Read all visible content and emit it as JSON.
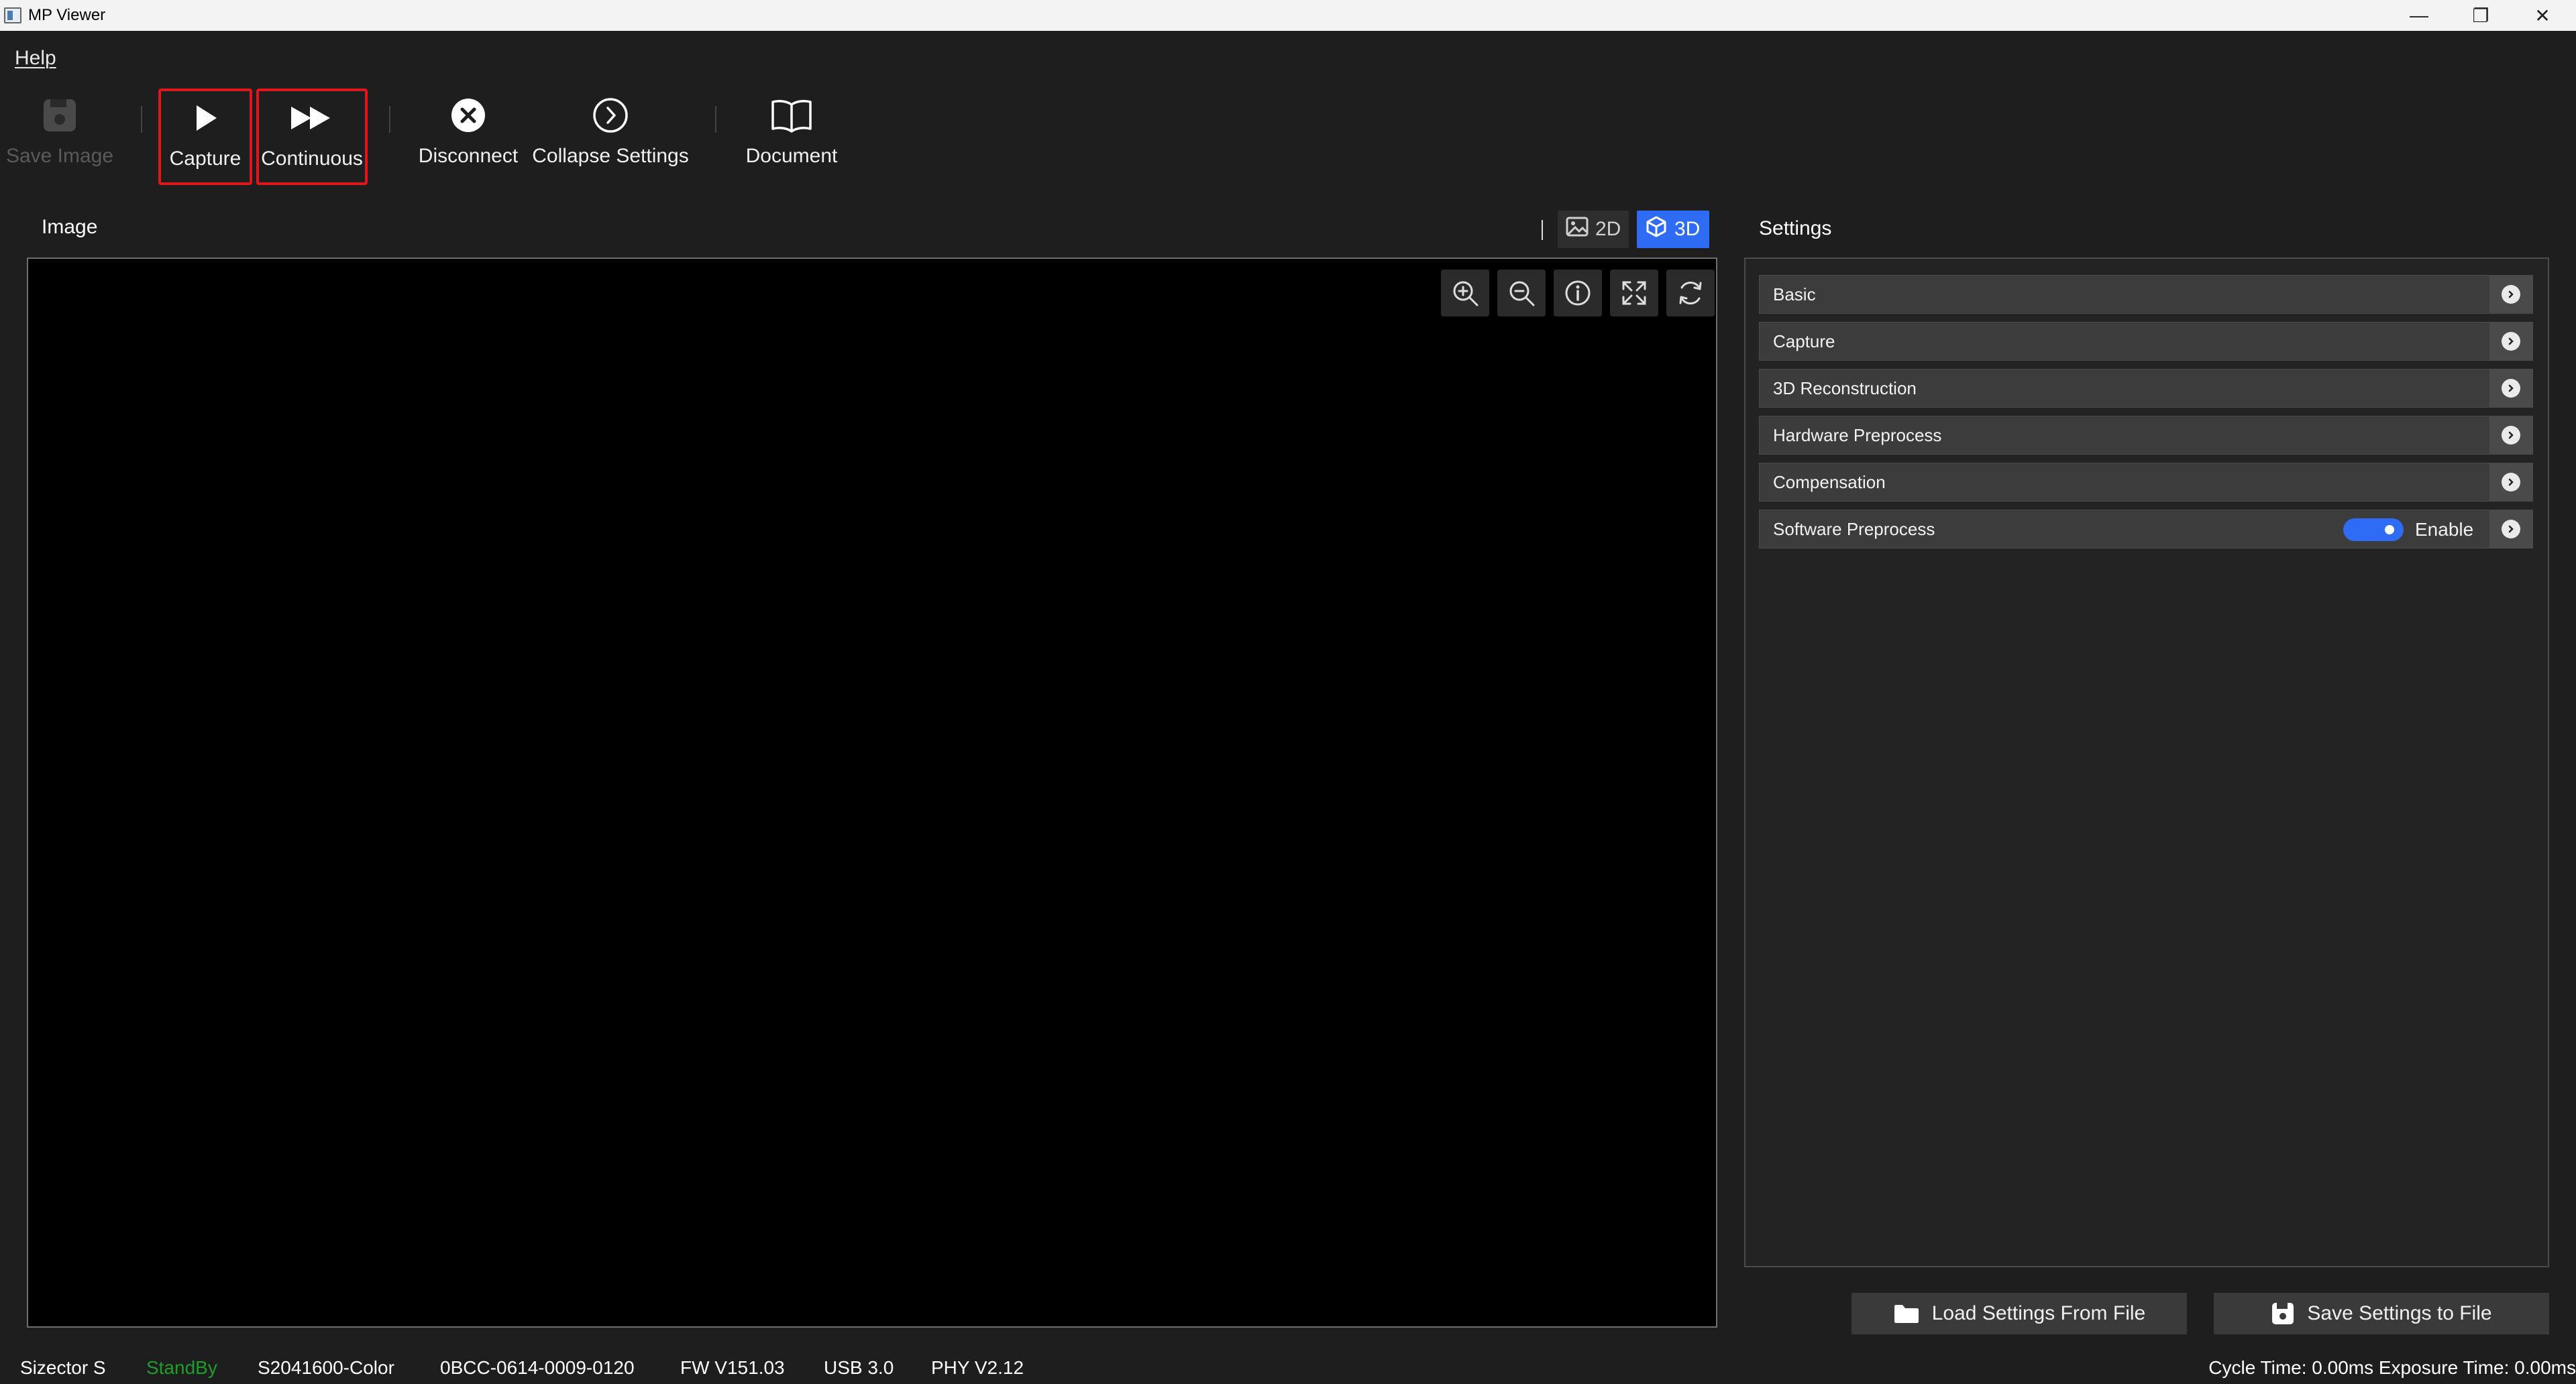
{
  "window": {
    "title": "MP Viewer",
    "minimize": "—",
    "maximize": "❐",
    "close": "✕"
  },
  "menu": {
    "help": "Help"
  },
  "toolbar": {
    "save_image": "Save Image",
    "capture": "Capture",
    "continuous": "Continuous",
    "disconnect": "Disconnect",
    "collapse_settings": "Collapse Settings",
    "document": "Document"
  },
  "image_panel": {
    "title": "Image",
    "view_2d": "2D",
    "view_3d": "3D",
    "active_view": "3D"
  },
  "settings": {
    "title": "Settings",
    "sections": [
      {
        "label": "Basic"
      },
      {
        "label": "Capture"
      },
      {
        "label": "3D Reconstruction"
      },
      {
        "label": "Hardware Preprocess"
      },
      {
        "label": "Compensation"
      },
      {
        "label": "Software Preprocess",
        "toggle_label": "Enable",
        "enabled": true
      }
    ],
    "load_button": "Load Settings From File",
    "save_button": "Save Settings to File"
  },
  "status": {
    "device": "Sizector S",
    "state": "StandBy",
    "model": "S2041600-Color",
    "serial": "0BCC-0614-0009-0120",
    "firmware": "FW V151.03",
    "usb": "USB 3.0",
    "phy": "PHY V2.12",
    "timing": "Cycle Time: 0.00ms Exposure Time: 0.00ms"
  },
  "colors": {
    "accent": "#2f6cf6",
    "highlight": "#e0161b",
    "standby": "#1f9d2a"
  }
}
